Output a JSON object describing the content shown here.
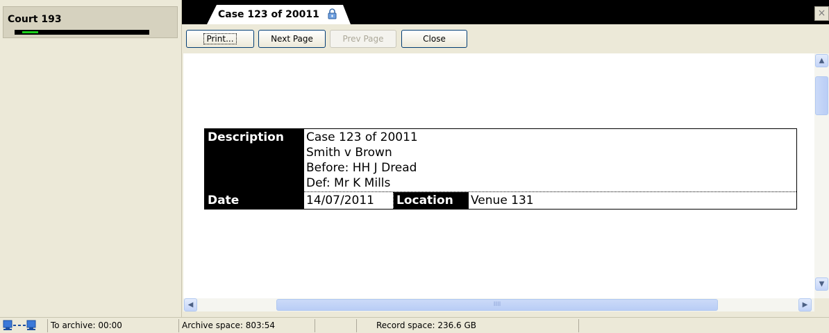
{
  "left_panel": {
    "court_title": "Court 193",
    "meter_level": 0.12
  },
  "tab": {
    "label": "Case 123 of 20011",
    "icon": "lock-icon",
    "close_glyph": "×"
  },
  "toolbar": {
    "print_label": "Print...",
    "next_page_label": "Next Page",
    "prev_page_label": "Prev Page",
    "close_label": "Close"
  },
  "document": {
    "description_label": "Description",
    "description_lines": [
      "Case 123 of 20011",
      "Smith v Brown",
      "Before: HH J Dread",
      "Def: Mr K Mills"
    ],
    "date_label": "Date",
    "date_value": "14/07/2011",
    "location_label": "Location",
    "location_value": "Venue 131"
  },
  "scrollbars": {
    "up_arrow": "▲",
    "down_arrow": "▼",
    "left_arrow": "◀",
    "right_arrow": "▶",
    "grip": "IIII"
  },
  "statusbar": {
    "network_icon": "network-connection-icon",
    "archive_time": "To archive: 00:00",
    "archive_space": "Archive space: 803:54",
    "record_space": "Record space: 236.6 GB"
  },
  "colors": {
    "accent_green": "#1bd01b",
    "panel_bg": "#ece9d8",
    "label_bg": "#000000"
  }
}
